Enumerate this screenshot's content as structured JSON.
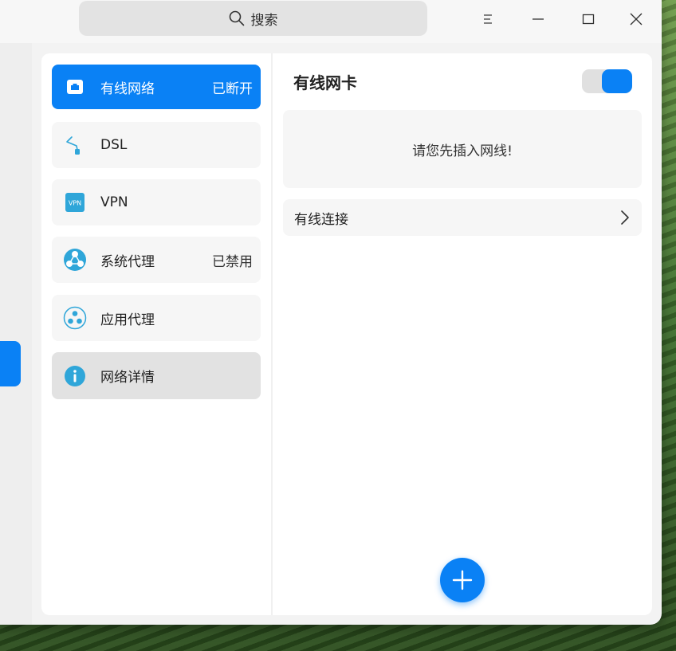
{
  "search": {
    "label": "搜索"
  },
  "sidebar": {
    "items": [
      {
        "label": "有线网络",
        "status": "已断开",
        "icon": "wired-network-icon"
      },
      {
        "label": "DSL",
        "status": "",
        "icon": "dsl-icon"
      },
      {
        "label": "VPN",
        "status": "",
        "icon": "vpn-icon",
        "icon_text": "VPN"
      },
      {
        "label": "系统代理",
        "status": "已禁用",
        "icon": "system-proxy-icon"
      },
      {
        "label": "应用代理",
        "status": "",
        "icon": "app-proxy-icon"
      },
      {
        "label": "网络详情",
        "status": "",
        "icon": "info-icon"
      }
    ]
  },
  "main": {
    "title": "有线网卡",
    "toggle_on": true,
    "message": "请您先插入网线!",
    "connection_label": "有线连接"
  },
  "colors": {
    "accent": "#0a81f5",
    "icon_teal": "#2fa6d9"
  }
}
